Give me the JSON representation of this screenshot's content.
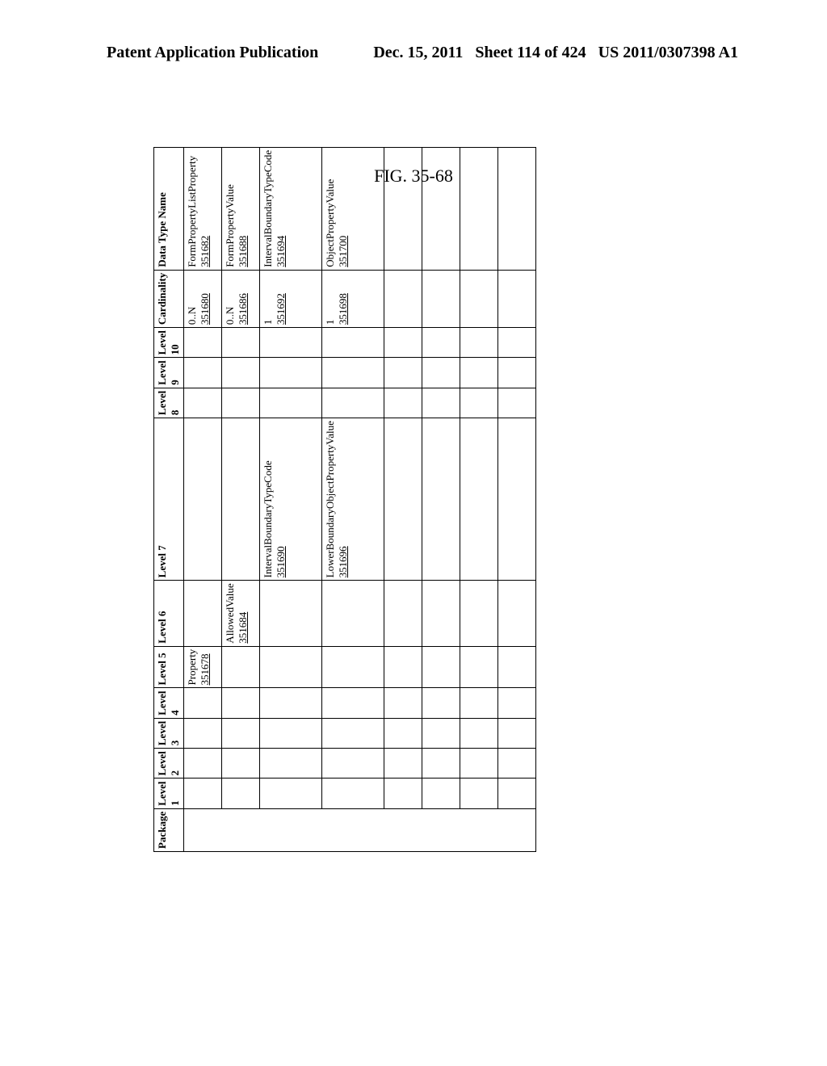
{
  "header": {
    "left": "Patent Application Publication",
    "date": "Dec. 15, 2011",
    "sheet": "Sheet 114 of 424",
    "pubno": "US 2011/0307398 A1"
  },
  "figure_label": "FIG. 35-68",
  "columns": [
    "Package",
    "Level 1",
    "Level 2",
    "Level 3",
    "Level 4",
    "Level 5",
    "Level 6",
    "Level 7",
    "Level 8",
    "Level 9",
    "Level 10",
    "Cardinality",
    "Data Type Name"
  ],
  "rows": [
    {
      "level5": "Property",
      "level5_ref": "351678",
      "card": "0..N",
      "card_ref": "351680",
      "dtn": "FormPropertyListProperty",
      "dtn_ref": "351682"
    },
    {
      "level6": "AllowedValue",
      "level6_ref": "351684",
      "card": "0..N",
      "card_ref": "351686",
      "dtn": "FormPropertyValue",
      "dtn_ref": "351688"
    },
    {
      "level7": "IntervalBoundaryTypeCode",
      "level7_ref": "351690",
      "card": "1",
      "card_ref": "351692",
      "dtn": "IntervalBoundaryTypeCode",
      "dtn_ref": "351694"
    },
    {
      "level7": "LowerBoundaryObjectPropertyValue",
      "level7_ref": "351696",
      "card": "1",
      "card_ref": "351698",
      "dtn": "ObjectPropertyValue",
      "dtn_ref": "351700"
    }
  ]
}
